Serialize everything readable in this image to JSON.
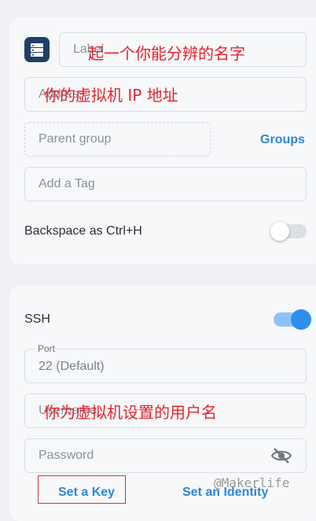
{
  "general": {
    "label_placeholder": "Label",
    "address_placeholder": "Address",
    "parent_group_placeholder": "Parent group",
    "groups_link": "Groups",
    "tag_placeholder": "Add a Tag",
    "backspace_label": "Backspace as Ctrl+H",
    "backspace_enabled": false
  },
  "ssh": {
    "title": "SSH",
    "enabled": true,
    "port_label": "Port",
    "port_value": "22 (Default)",
    "username_placeholder": "Username",
    "password_placeholder": "Password",
    "set_key_label": "Set a Key",
    "set_identity_label": "Set an Identity"
  },
  "annotations": {
    "label_note": "起一个你能分辨的名字",
    "address_note": "你的虚拟机 IP 地址",
    "username_note": "你为虚拟机设置的用户名"
  },
  "watermark": "@Makerlife",
  "colors": {
    "accent": "#2d8ef0",
    "annotation": "#e3242b"
  }
}
